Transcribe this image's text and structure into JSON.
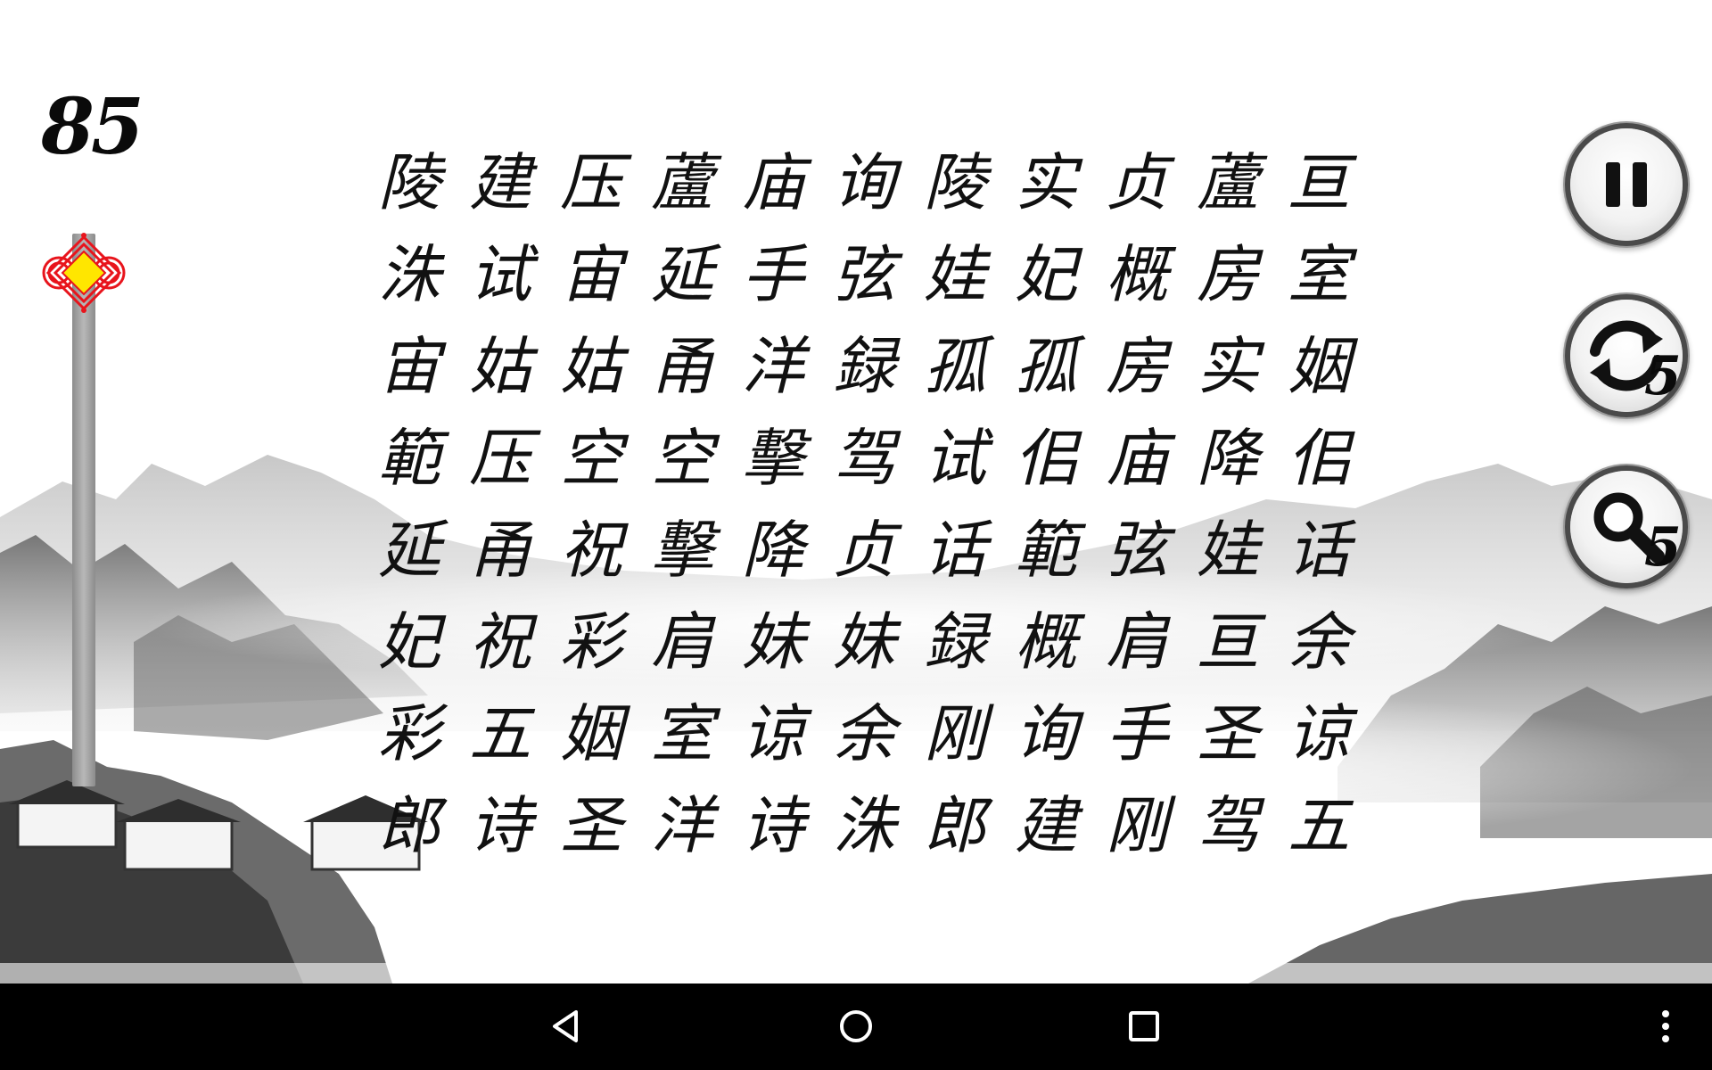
{
  "game": {
    "score": "85",
    "timer_fraction_remaining": 1.0,
    "shuffle_count": "5",
    "hint_count": "5"
  },
  "board": {
    "rows": [
      [
        "陵",
        "建",
        "压",
        "蘆",
        "庙",
        "询",
        "陵",
        "实",
        "贞",
        "蘆",
        "亘"
      ],
      [
        "洙",
        "试",
        "宙",
        "延",
        "手",
        "弦",
        "娃",
        "妃",
        "概",
        "房",
        "室"
      ],
      [
        "宙",
        "姑",
        "姑",
        "甬",
        "洋",
        "録",
        "孤",
        "孤",
        "房",
        "实",
        "姻"
      ],
      [
        "範",
        "压",
        "空",
        "空",
        "擊",
        "驾",
        "试",
        "佀",
        "庙",
        "降",
        "佀"
      ],
      [
        "延",
        "甬",
        "祝",
        "擊",
        "降",
        "贞",
        "话",
        "範",
        "弦",
        "娃",
        "话"
      ],
      [
        "妃",
        "祝",
        "彩",
        "肩",
        "妹",
        "妹",
        "録",
        "概",
        "肩",
        "亘",
        "余"
      ],
      [
        "彩",
        "五",
        "姻",
        "室",
        "谅",
        "余",
        "刚",
        "询",
        "手",
        "圣",
        "谅"
      ],
      [
        "郎",
        "诗",
        "圣",
        "洋",
        "诗",
        "洙",
        "郎",
        "建",
        "刚",
        "驾",
        "五"
      ]
    ]
  },
  "controls": {
    "pause_icon": "pause-icon",
    "shuffle_icon": "refresh-icon",
    "hint_icon": "magnifier-icon"
  },
  "navbar": {
    "back_icon": "back-triangle-icon",
    "home_icon": "home-circle-icon",
    "recent_icon": "recent-square-icon",
    "menu_icon": "overflow-menu-icon"
  },
  "colors": {
    "knot_red": "#e8141c",
    "knot_yellow": "#ffe600",
    "ink": "#111111"
  }
}
